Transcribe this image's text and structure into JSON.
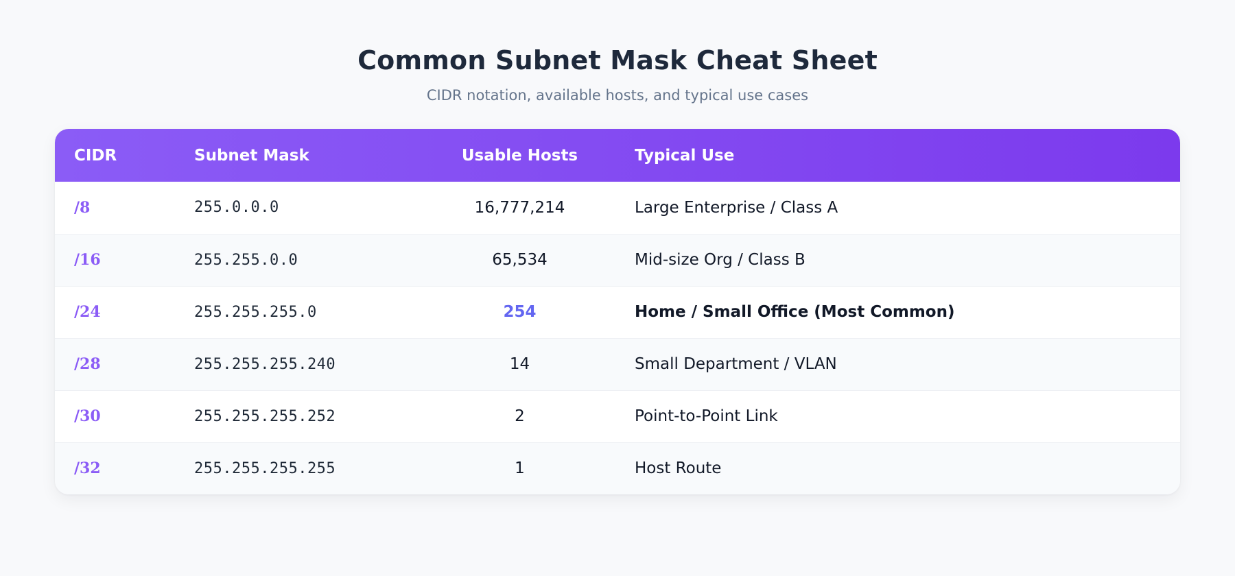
{
  "header": {
    "title": "Common Subnet Mask Cheat Sheet",
    "subtitle": "CIDR notation, available hosts, and typical use cases"
  },
  "table": {
    "columns": [
      "CIDR",
      "Subnet Mask",
      "Usable Hosts",
      "Typical Use"
    ],
    "rows": [
      {
        "cidr": "/8",
        "mask": "255.0.0.0",
        "hosts": "16,777,214",
        "use": "Large Enterprise / Class A",
        "highlight": false
      },
      {
        "cidr": "/16",
        "mask": "255.255.0.0",
        "hosts": "65,534",
        "use": "Mid-size Org / Class B",
        "highlight": false
      },
      {
        "cidr": "/24",
        "mask": "255.255.255.0",
        "hosts": "254",
        "use": "Home / Small Office (Most Common)",
        "highlight": true
      },
      {
        "cidr": "/28",
        "mask": "255.255.255.240",
        "hosts": "14",
        "use": "Small Department / VLAN",
        "highlight": false
      },
      {
        "cidr": "/30",
        "mask": "255.255.255.252",
        "hosts": "2",
        "use": "Point-to-Point Link",
        "highlight": false
      },
      {
        "cidr": "/32",
        "mask": "255.255.255.255",
        "hosts": "1",
        "use": "Host Route",
        "highlight": false
      }
    ]
  },
  "colors": {
    "header_gradient_start": "#8b5cf6",
    "header_gradient_end": "#7c3aed",
    "cidr_text": "#8b5cf6",
    "highlight_hosts": "#6366f1",
    "title_text": "#1e293b",
    "subtitle_text": "#64748b",
    "background": "#f8f9fb"
  }
}
